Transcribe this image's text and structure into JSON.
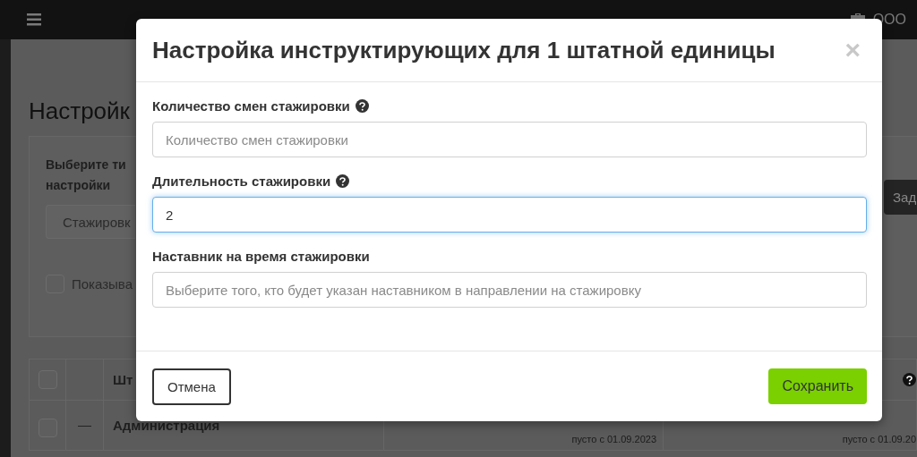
{
  "topbar": {
    "company": "ООО"
  },
  "page": {
    "title": "Настройк",
    "filter": {
      "type_label_lines": [
        "Выберите ти",
        "настройки"
      ],
      "type_value": "Стажировк",
      "show_checkbox": {
        "label": "Показыва",
        "checked": false
      },
      "action_button": "Зад"
    },
    "table": {
      "header": {
        "checked": false,
        "column_3": "Шт",
        "help": true
      },
      "rows": [
        {
          "checked": false,
          "toggle": "—",
          "name": "Администрация",
          "column_4": "пусто с 01.09.2023",
          "column_5": "пусто с 01.09.20"
        }
      ]
    }
  },
  "dialog": {
    "title": "Настройка инструктирующих для 1 штатной единицы",
    "close": "×",
    "fields": [
      {
        "label": "Количество смен стажировки",
        "help": true,
        "placeholder": "Количество смен стажировки",
        "focused": false
      },
      {
        "label": "Длительность стажировки",
        "help": true,
        "value": "2",
        "focused": true
      },
      {
        "label": "Наставник на время стажировки",
        "help": false,
        "placeholder": "Выберите того, кто будет указан наставником в направлении на стажировку",
        "focused": false
      }
    ],
    "cancel": "Отмена",
    "save": "Сохранить"
  }
}
